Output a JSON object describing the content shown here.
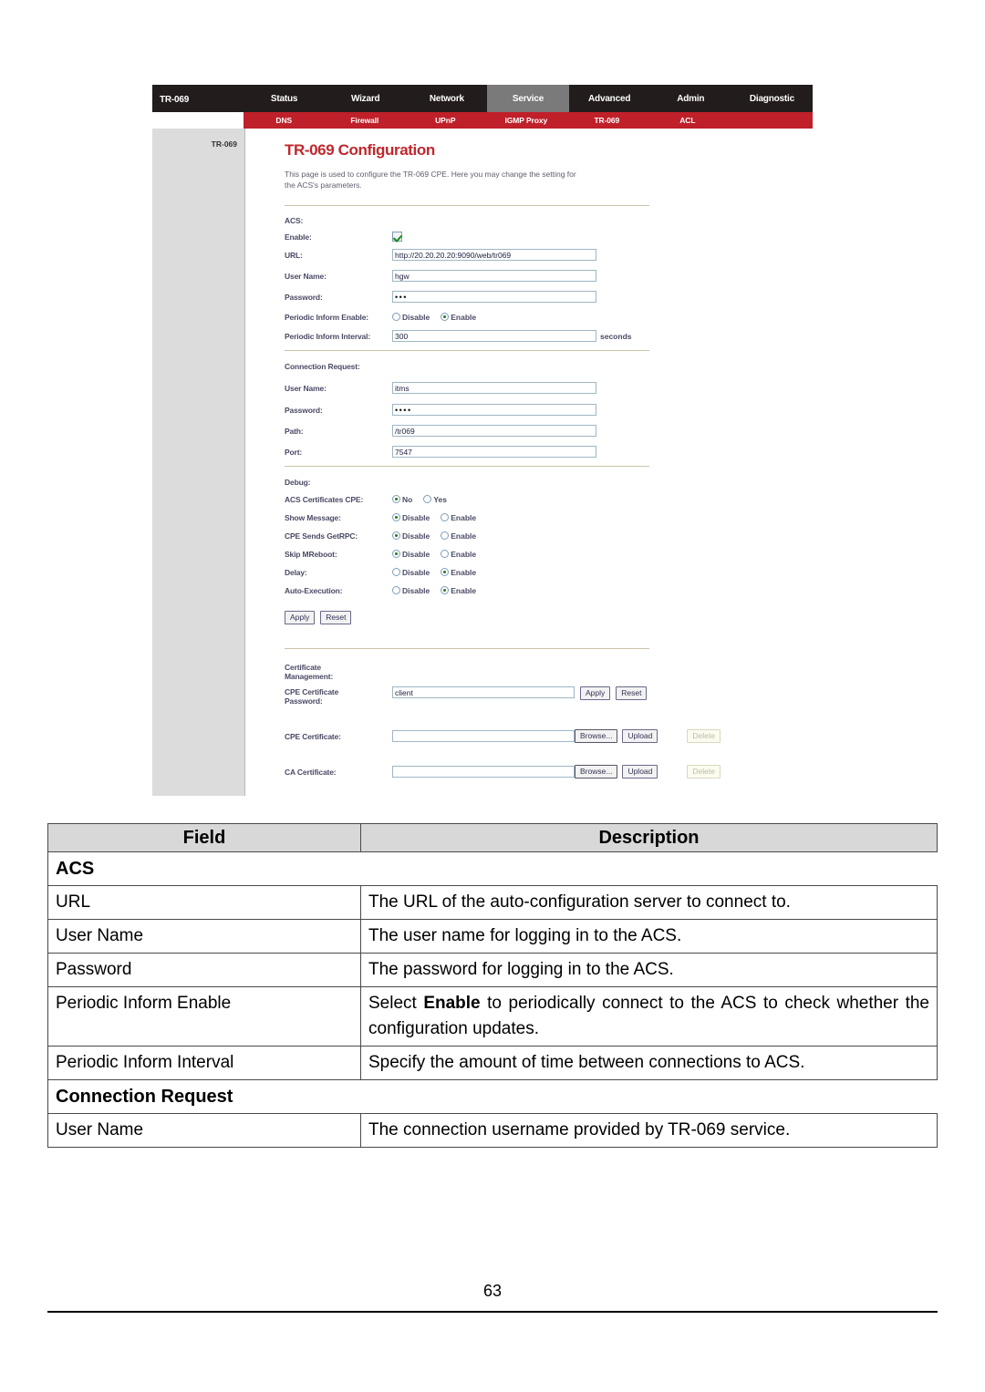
{
  "router_ui": {
    "brand": "TR-069",
    "nav_tabs": [
      {
        "label": "Status",
        "active": false
      },
      {
        "label": "Wizard",
        "active": false
      },
      {
        "label": "Network",
        "active": false
      },
      {
        "label": "Service",
        "active": true
      },
      {
        "label": "Advanced",
        "active": false
      },
      {
        "label": "Admin",
        "active": false
      },
      {
        "label": "Diagnostic",
        "active": false
      }
    ],
    "sub_nav_tabs": [
      {
        "label": "DNS"
      },
      {
        "label": "Firewall"
      },
      {
        "label": "UPnP"
      },
      {
        "label": "IGMP Proxy"
      },
      {
        "label": "TR-069"
      },
      {
        "label": "ACL"
      }
    ],
    "sidebar": {
      "items": [
        "TR-069"
      ]
    },
    "page_title": "TR-069 Configuration",
    "page_description": "This page is used to configure the TR-069 CPE. Here you may change the setting for the ACS's parameters.",
    "acs": {
      "group_label": "ACS:",
      "enable_label": "Enable:",
      "enable_checked": true,
      "url_label": "URL:",
      "url_value": "http://20.20.20.20:9090/web/tr069",
      "username_label": "User Name:",
      "username_value": "hgw",
      "password_label": "Password:",
      "password_value": "•••",
      "periodic_inform_enable_label": "Periodic Inform Enable:",
      "periodic_inform_enable_options": [
        "Disable",
        "Enable"
      ],
      "periodic_inform_enable_selected": "Enable",
      "periodic_inform_interval_label": "Periodic Inform Interval:",
      "periodic_inform_interval_value": "300",
      "periodic_inform_interval_unit": "seconds"
    },
    "connection_request": {
      "group_label": "Connection Request:",
      "username_label": "User Name:",
      "username_value": "itms",
      "password_label": "Password:",
      "password_value": "••••",
      "path_label": "Path:",
      "path_value": "/tr069",
      "port_label": "Port:",
      "port_value": "7547"
    },
    "debug": {
      "group_label": "Debug:",
      "rows": [
        {
          "label": "ACS Certificates CPE:",
          "options": [
            "No",
            "Yes"
          ],
          "selected": "No"
        },
        {
          "label": "Show Message:",
          "options": [
            "Disable",
            "Enable"
          ],
          "selected": "Disable"
        },
        {
          "label": "CPE Sends GetRPC:",
          "options": [
            "Disable",
            "Enable"
          ],
          "selected": "Disable"
        },
        {
          "label": "Skip MReboot:",
          "options": [
            "Disable",
            "Enable"
          ],
          "selected": "Disable"
        },
        {
          "label": "Delay:",
          "options": [
            "Disable",
            "Enable"
          ],
          "selected": "Enable"
        },
        {
          "label": "Auto-Execution:",
          "options": [
            "Disable",
            "Enable"
          ],
          "selected": "Enable"
        }
      ],
      "apply_label": "Apply",
      "reset_label": "Reset"
    },
    "certificate_management": {
      "group_label_line1": "Certificate",
      "group_label_line2": "Management:",
      "cpe_cert_password_label_line1": "CPE Certificate",
      "cpe_cert_password_label_line2": "Password:",
      "cpe_cert_password_value": "client",
      "apply_label": "Apply",
      "reset_label": "Reset",
      "cpe_certificate_label": "CPE Certificate:",
      "cpe_certificate_value": "",
      "ca_certificate_label": "CA Certificate:",
      "ca_certificate_value": "",
      "browse_label": "Browse...",
      "upload_label": "Upload",
      "delete_label": "Delete"
    },
    "colors": {
      "nav_background": "#221c1c",
      "subnav_background": "#bf2029",
      "active_tab": "#7a7a7a",
      "title_red": "#c1272d",
      "sidebar_gray": "#dcdcdc"
    }
  },
  "doc_table": {
    "headers": [
      "Field",
      "Description"
    ],
    "rows": [
      {
        "type": "group",
        "field": "ACS"
      },
      {
        "type": "data",
        "field": "URL",
        "description": "The URL of the auto-configuration server to connect to."
      },
      {
        "type": "data",
        "field": "User Name",
        "description": "The user name for logging in to the ACS."
      },
      {
        "type": "data",
        "field": "Password",
        "description": "The password for logging in to the ACS."
      },
      {
        "type": "data",
        "field": "Periodic Inform Enable",
        "description_pre": "Select ",
        "description_bold": "Enable",
        "description_post": " to periodically connect to the ACS to check whether the configuration updates."
      },
      {
        "type": "data",
        "field": "Periodic Inform Interval",
        "description": "Specify the amount of time between connections to ACS."
      },
      {
        "type": "group",
        "field": "Connection Request"
      },
      {
        "type": "data",
        "field": "User Name",
        "description": "The connection username provided by TR-069 service."
      }
    ]
  },
  "footer": {
    "page_number": "63"
  }
}
